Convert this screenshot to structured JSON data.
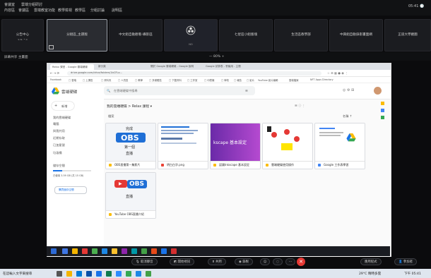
{
  "app": {
    "title": "會議室",
    "subtitle": "雲端分組研討",
    "menus": [
      "內容區",
      "會議區",
      "雲端教室功能",
      "教學檢視",
      "教學區",
      "分組討論",
      "說明區"
    ],
    "clock": "05:41 🕒"
  },
  "scenes": [
    {
      "label": "公告中心",
      "sub": "s.w. • o"
    },
    {
      "label": "分組區_主題版",
      "sub": ""
    },
    {
      "label": "中文組自動觀看-攝影區",
      "sub": ""
    },
    {
      "label": "OBS",
      "sub": "NO"
    },
    {
      "label": "七星區小組版塊",
      "sub": ""
    },
    {
      "label": "生活區教學部",
      "sub": ""
    },
    {
      "label": "中興組自動錄影畫面網",
      "sub": ""
    },
    {
      "label": "正道大學觀圖",
      "sub": ""
    }
  ],
  "subheader": {
    "left": "屏幕共享 主畫面",
    "zoom": "— 80% +"
  },
  "browser": {
    "tabs": [
      "Relax 課堂 - Google 雲端硬碟",
      "新分頁",
      "關於 Google 雲端硬碟 - Google 說明",
      "Google 試算表 - 會議用 - 主題"
    ],
    "url": "drive.google.com/drive/folders/1bCFLo...",
    "bookmarks": [
      "Facebook",
      "□ 雲端",
      "□ 上課區",
      "□ 資料夾",
      "□ 人員區",
      "□ 教學",
      "□ 多媒體區",
      "□ 下載資料",
      "□ 工作室",
      "□ 印表機",
      "□ 學校",
      "□ 報告",
      "□ 影片",
      "YouTube 影片編輯",
      "雲端檔案",
      "NFT Apps Directory"
    ],
    "drive_title": "雲端硬碟",
    "search_placeholder": "在雲端硬碟中搜尋",
    "breadcrumb": "我的雲端硬碟 > Relax 課程 ▾",
    "new_button": "新增",
    "section_title": "檔案",
    "sort_label": "名稱 ↑",
    "sidebar": [
      "我的雲端硬碟",
      "電腦",
      "與我共用",
      "近期存取",
      "已加星號",
      "垃圾桶",
      "儲存空間"
    ],
    "storage_text": "已使用 3.59 GB (共 15 GB)",
    "storage_button": "購買儲存空間",
    "files": [
      {
        "name": "OBS 第一集 直播.mp4",
        "caption": "OBS直播第一集影片"
      },
      {
        "name": "明白白字.png",
        "caption": "明白白字.png"
      },
      {
        "name": "認識Inkscape 基本設定",
        "caption": "認識Inkscape 基本設定"
      },
      {
        "name": "雲端硬碟使用操作",
        "caption": "雲端硬碟使用操作"
      },
      {
        "name": "Google 工作表學習",
        "caption": "Google 工作表學習"
      },
      {
        "name": "YouTube OBS 直播",
        "caption": "YouTube OBS直播介紹"
      }
    ],
    "thumb1": {
      "l1": "完成",
      "l2": "OBS",
      "l3": "第一個",
      "l4": "直播"
    },
    "thumb6": {
      "l1": "YouTube",
      "l2": "OBS",
      "l3": "直播"
    }
  },
  "controls": [
    "取消靜音",
    "開始視訊",
    "共用",
    "錄製",
    "",
    ""
  ],
  "controls_right": [
    "應用程式",
    "參加者"
  ],
  "host_taskbar": {
    "search": "在這輸入文字來搜尋",
    "weather": "29°C 晴時多雲",
    "time": "下午 05:41"
  },
  "colors": {
    "accent": "#1a73e8",
    "obs_blue": "#1f6fd6",
    "red": "#e53935"
  }
}
